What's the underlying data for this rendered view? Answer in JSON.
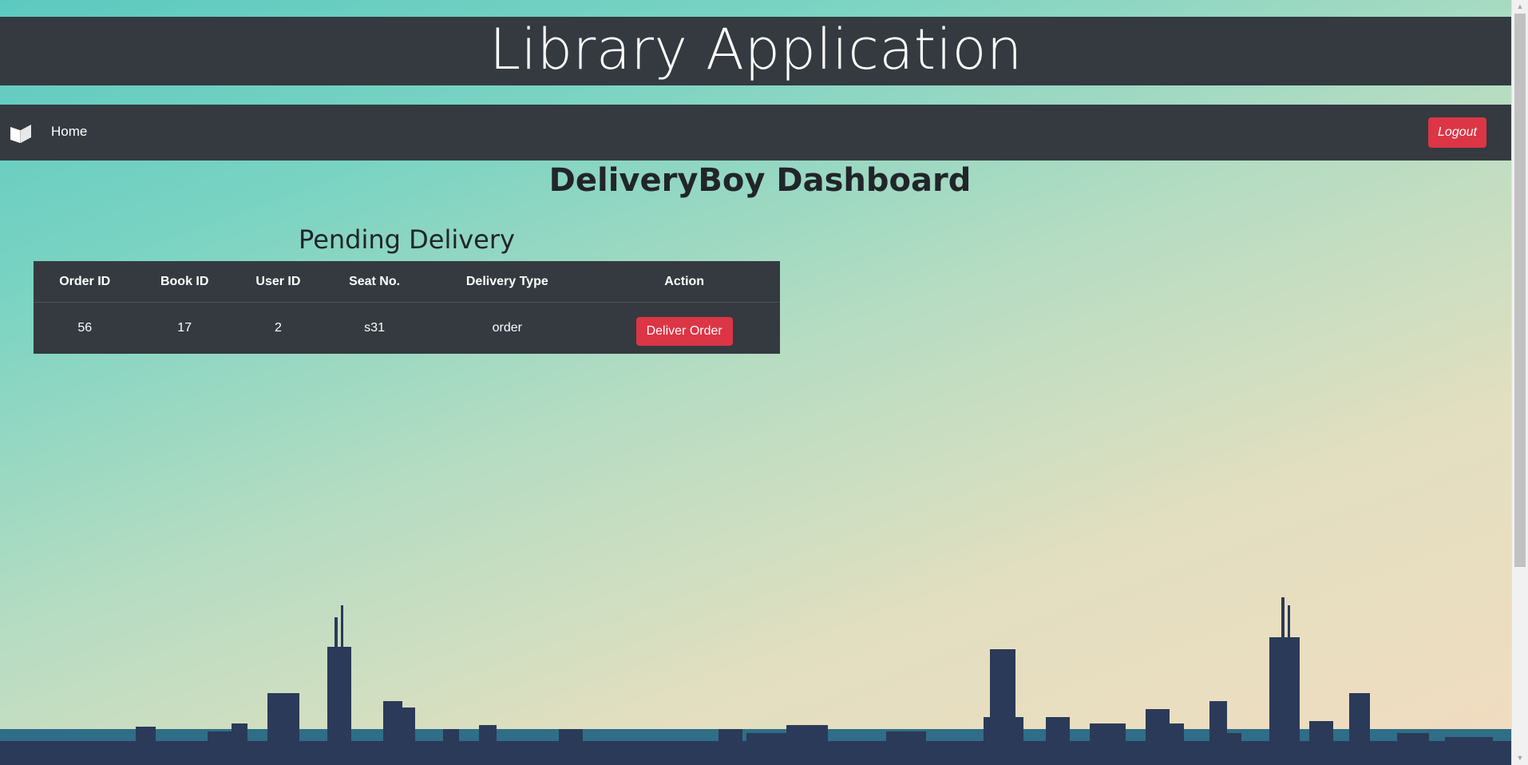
{
  "app": {
    "title": "Library Application"
  },
  "navbar": {
    "brand_icon": "open-book-icon",
    "home_label": "Home",
    "logout_label": "Logout"
  },
  "dashboard": {
    "title": "DeliveryBoy Dashboard",
    "section_title": "Pending Delivery"
  },
  "table": {
    "headers": [
      "Order ID",
      "Book ID",
      "User ID",
      "Seat No.",
      "Delivery Type",
      "Action"
    ],
    "rows": [
      {
        "order_id": "56",
        "book_id": "17",
        "user_id": "2",
        "seat_no": "s31",
        "delivery_type": "order",
        "action_label": "Deliver Order"
      }
    ]
  },
  "colors": {
    "dark_bar": "#343a40",
    "danger": "#dc3545",
    "sky_top": "#5cc9c0",
    "sky_bottom": "#f2dcc0",
    "skyline": "#2b3a58"
  }
}
